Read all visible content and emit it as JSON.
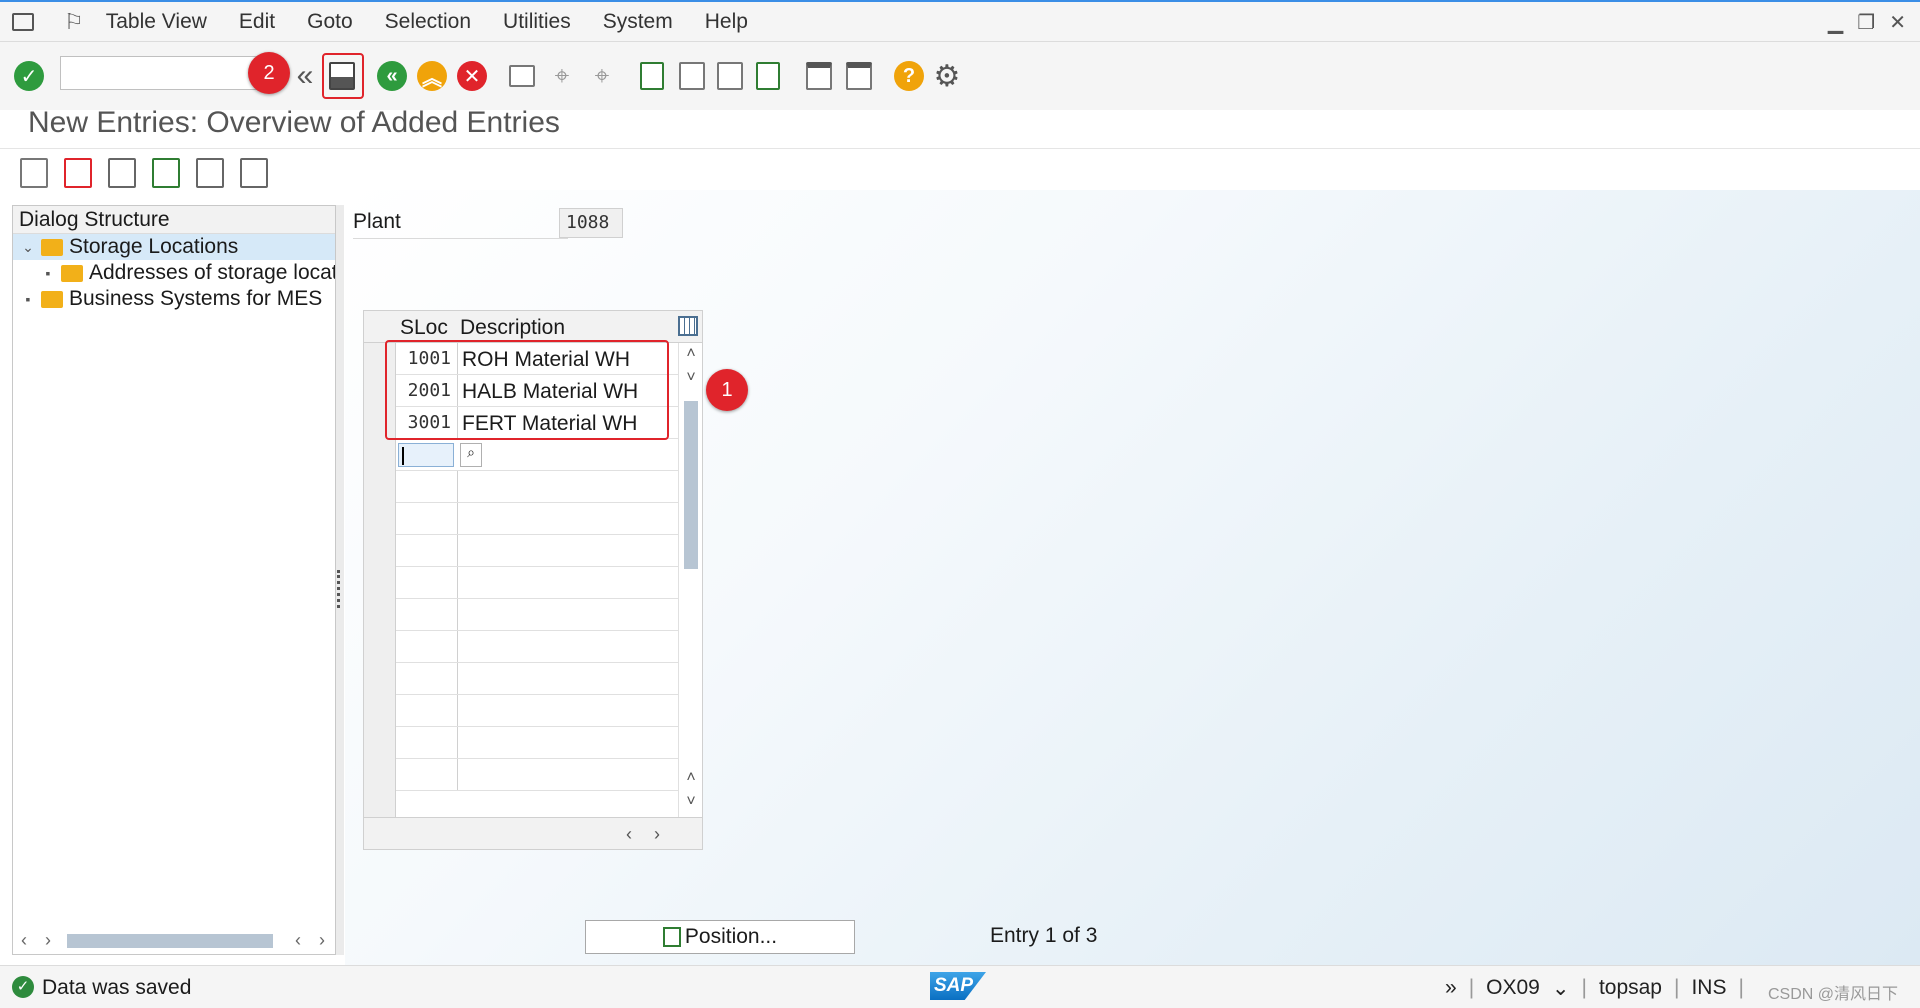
{
  "menu": {
    "items": [
      "Table View",
      "Edit",
      "Goto",
      "Selection",
      "Utilities",
      "System",
      "Help"
    ]
  },
  "toolbar": {
    "command_value": "",
    "save_icon": "save-icon",
    "annotation_save": "2"
  },
  "title": "New Entries: Overview of Added Entries",
  "dialog_structure": {
    "header": "Dialog Structure",
    "items": [
      {
        "label": "Storage Locations",
        "level": 0,
        "expanded": true,
        "selected": true
      },
      {
        "label": "Addresses of storage locati",
        "level": 1,
        "expanded": false,
        "selected": false
      },
      {
        "label": "Business Systems for MES",
        "level": 0,
        "expanded": false,
        "selected": false
      }
    ]
  },
  "plant": {
    "label": "Plant",
    "value": "1088"
  },
  "table": {
    "columns": [
      "SLoc",
      "Description"
    ],
    "rows": [
      {
        "sloc": "1001",
        "description": "ROH Material WH"
      },
      {
        "sloc": "2001",
        "description": "HALB Material WH"
      },
      {
        "sloc": "3001",
        "description": "FERT Material WH"
      }
    ],
    "annotation_rows": "1"
  },
  "position_button": "Position...",
  "entry_info": "Entry 1 of 3",
  "status": {
    "message": "Data was saved",
    "transaction": "OX09",
    "server": "topsap",
    "mode": "INS",
    "watermark": "CSDN @清风日下"
  },
  "colors": {
    "accent": "#3a8ee6",
    "annotation": "#e0242b",
    "ok": "#2e8b3d",
    "folder": "#f2b019"
  }
}
